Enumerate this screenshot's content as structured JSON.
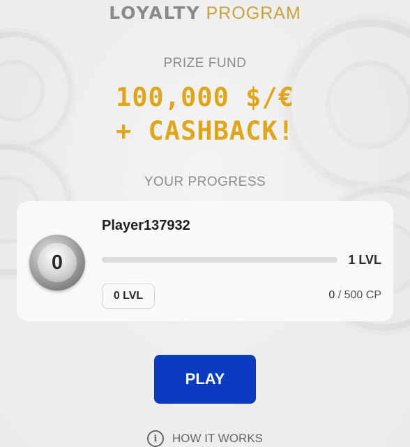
{
  "header": {
    "logo_word1": "LOYALTY",
    "logo_word2": "PROGRAM"
  },
  "prize": {
    "label": "PRIZE FUND",
    "line1": "100,000 $/€",
    "line2": "+ CASHBACK!"
  },
  "progress": {
    "label": "YOUR PROGRESS",
    "player_name": "Player137932",
    "badge_level": "0",
    "current_level": "0 LVL",
    "next_level": "1 LVL",
    "points_current": "0",
    "points_separator": " / ",
    "points_target": "500 CP",
    "fill_percent": 0
  },
  "actions": {
    "play_label": "PLAY",
    "how_it_works_label": "HOW IT WORKS",
    "info_icon_glyph": "i"
  },
  "colors": {
    "accent_blue": "#0a3bc0",
    "gold": "#e0a61a",
    "logo_gold": "#caa23c",
    "muted_text": "#8c8c8c"
  },
  "icons": {
    "info": "info-circle-icon",
    "badge": "level-badge-icon"
  }
}
